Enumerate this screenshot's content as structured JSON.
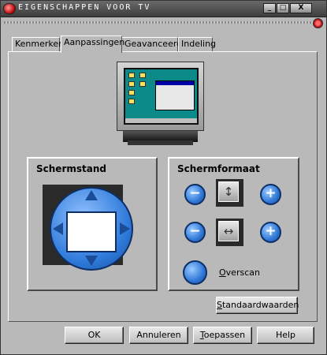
{
  "window": {
    "title": "Eigenschappen voor TV",
    "minimize": "_",
    "maximize": "□",
    "close": "X"
  },
  "tabs": [
    {
      "label": "Kenmerken"
    },
    {
      "label": "Aanpassingen",
      "active": true
    },
    {
      "label": "Geavanceerd"
    },
    {
      "label": "Indeling"
    }
  ],
  "schermstand": {
    "title": "Schermstand"
  },
  "schermformaat": {
    "title": "Schermformaat",
    "minus_symbol": "−",
    "plus_symbol": "+",
    "vertical_icon": "↕",
    "horizontal_icon": "↔",
    "overscan_prefix": "O",
    "overscan_rest": "verscan"
  },
  "buttons": {
    "defaults_prefix": "S",
    "defaults_rest": "tandaardwaarden",
    "ok": "OK",
    "cancel": "Annuleren",
    "apply_prefix": "T",
    "apply_rest": "oepassen",
    "help": "Help"
  },
  "colors": {
    "accent_blue": "#2d78d8",
    "title_bar": "#4a4a4a",
    "close_button_red": "#c00000"
  }
}
